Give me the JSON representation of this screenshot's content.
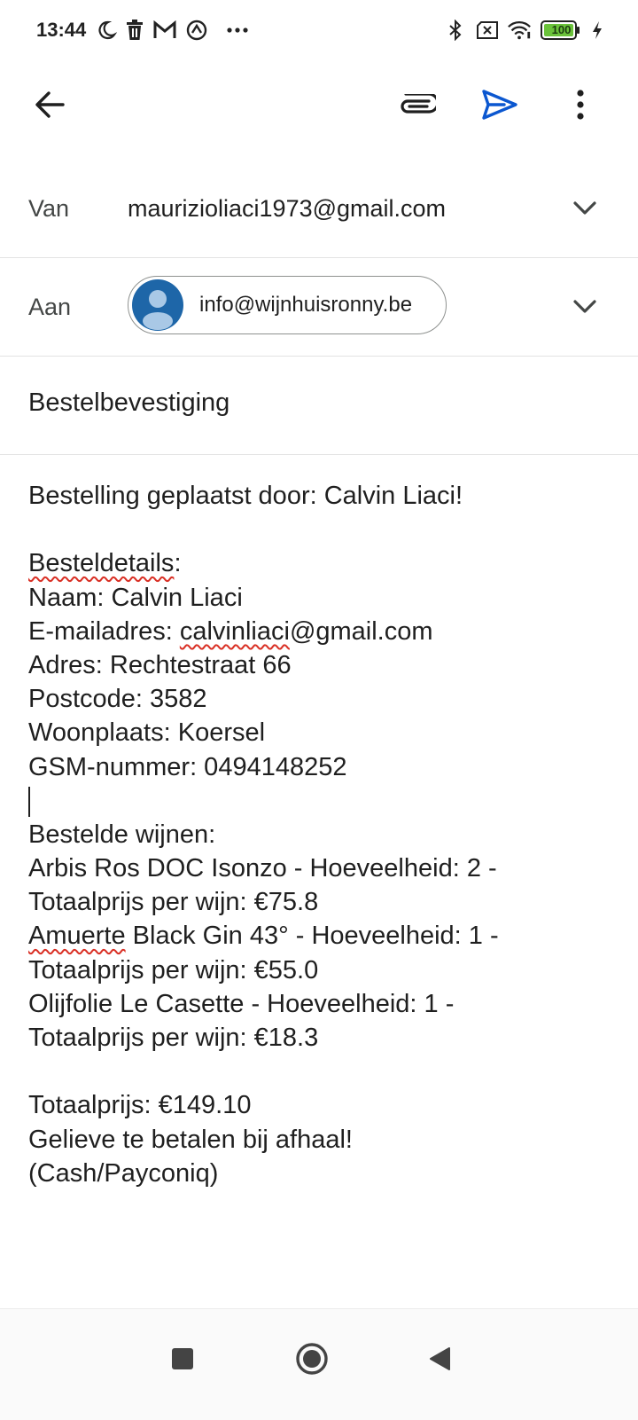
{
  "status_bar": {
    "time": "13:44",
    "left_icons": [
      "moon-icon",
      "trash-icon",
      "gmail-icon",
      "vpn-icon",
      "more-dots-icon"
    ],
    "right_icons": [
      "bluetooth-icon",
      "sim-off-icon",
      "wifi-icon",
      "battery-icon",
      "charging-icon"
    ],
    "battery_level": "100",
    "battery_color": "#6ac23a"
  },
  "toolbar": {
    "back_icon": "back-arrow-icon",
    "attach_icon": "paperclip-icon",
    "send_icon": "send-icon",
    "more_icon": "more-vert-icon",
    "accent_color": "#0b57d0"
  },
  "from": {
    "label": "Van",
    "value": "maurizioliaci1973@gmail.com"
  },
  "to": {
    "label": "Aan",
    "recipient": "info@wijnhuisronny.be"
  },
  "subject": {
    "value": "Bestelbevestiging"
  },
  "body": {
    "greeting": "Bestelling geplaatst door: Calvin Liaci!",
    "details_heading": "Besteldetails",
    "details_colon": ":",
    "naam": "Naam: Calvin Liaci",
    "email_prefix": "E-mailadres: ",
    "email_value": "calvinliaci",
    "email_domain": "@gmail.com",
    "adres": "Adres: Rechtestraat 66",
    "postcode": "Postcode: 3582",
    "woonplaats": "Woonplaats: Koersel",
    "gsm": "GSM-nummer: 0494148252",
    "wines_heading": "Bestelde wijnen:",
    "wine1_a": "Arbis Ros DOC Isonzo - Hoeveelheid: 2 -",
    "wine1_b": "Totaalprijs per wijn: €75.8",
    "wine2_word": "Amuerte",
    "wine2_rest": " Black Gin 43° - Hoeveelheid: 1 -",
    "wine2_b": "Totaalprijs per wijn: €55.0",
    "wine3_a": "Olijfolie Le Casette - Hoeveelheid: 1 -",
    "wine3_b": "Totaalprijs per wijn: €18.3",
    "total": "Totaalprijs: €149.10",
    "pay_note": "Gelieve te betalen bij afhaal!",
    "pay_methods": "(Cash/Payconiq)"
  },
  "nav_bar": {
    "icons": [
      "recents-square-icon",
      "home-circle-icon",
      "back-triangle-icon"
    ]
  }
}
